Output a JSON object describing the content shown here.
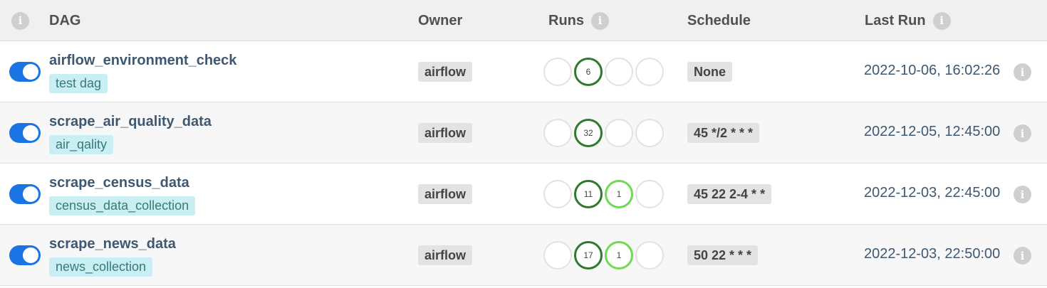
{
  "header": {
    "dag_label": "DAG",
    "owner_label": "Owner",
    "runs_label": "Runs",
    "schedule_label": "Schedule",
    "last_run_label": "Last Run",
    "info_glyph": "i"
  },
  "rows": [
    {
      "name": "airflow_environment_check",
      "tag": "test dag",
      "owner": "airflow",
      "runs": [
        "",
        "6",
        "",
        ""
      ],
      "schedule": "None",
      "last_run": "2022-10-06, 16:02:26",
      "enabled": true
    },
    {
      "name": "scrape_air_quality_data",
      "tag": "air_qality",
      "owner": "airflow",
      "runs": [
        "",
        "32",
        "",
        ""
      ],
      "schedule": "45 */2 * * *",
      "last_run": "2022-12-05, 12:45:00",
      "enabled": true
    },
    {
      "name": "scrape_census_data",
      "tag": "census_data_collection",
      "owner": "airflow",
      "runs": [
        "",
        "11",
        "1",
        ""
      ],
      "schedule": "45 22 2-4 * *",
      "last_run": "2022-12-03, 22:45:00",
      "enabled": true
    },
    {
      "name": "scrape_news_data",
      "tag": "news_collection",
      "owner": "airflow",
      "runs": [
        "",
        "17",
        "1",
        ""
      ],
      "schedule": "50 22 * * *",
      "last_run": "2022-12-03, 22:50:00",
      "enabled": true
    }
  ],
  "colors": {
    "toggle_on": "#1b74e4",
    "run_success": "#2d7a2d",
    "run_running": "#6fdb52",
    "tag_bg": "#c9eff3",
    "link_text": "#3e5871"
  },
  "icons": {
    "info": "info-icon"
  }
}
